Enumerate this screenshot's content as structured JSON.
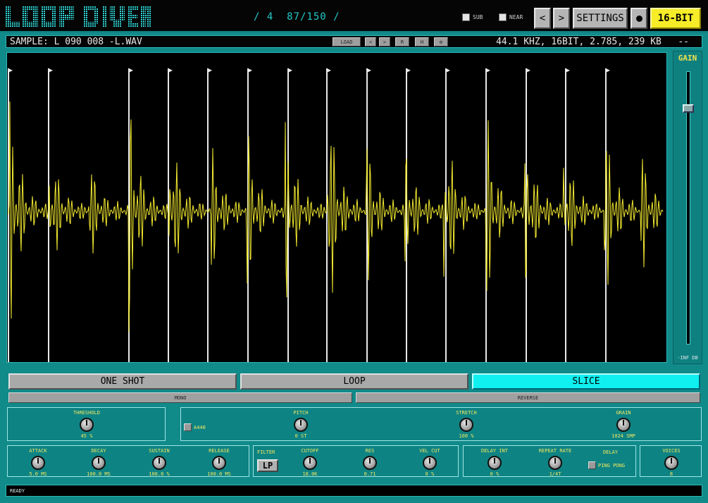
{
  "logo": {
    "text": "LOOP DIVER"
  },
  "header": {
    "counter": "/ 4  87/150 /",
    "sub_label": "SUB",
    "near_label": "NEAR",
    "prev_icon": "chevron-left",
    "next_icon": "chevron-right",
    "settings_label": "SETTINGS",
    "record_icon": "record-dot",
    "bit_depth_label": "16-BIT"
  },
  "sample": {
    "filename": "SAMPLE: L 090 008 -L.WAV",
    "meta": "44.1 KHZ, 16BIT, 2.785, 239 KB   --",
    "buttons": {
      "load": "LOAD",
      "prev": "<",
      "next": ">",
      "r": "R",
      "h": "H",
      "gear": "⚙"
    }
  },
  "gain": {
    "label": "GAIN",
    "bottom": "-INF DB",
    "level": 0.88
  },
  "modes": {
    "one_shot": "ONE SHOT",
    "loop": "LOOP",
    "slice": "SLICE",
    "active": "slice"
  },
  "options": {
    "mono": "MONO",
    "reverse": "REVERSE"
  },
  "threshold": {
    "label": "THRESHOLD",
    "value": "45 %"
  },
  "a440": {
    "label": "A440"
  },
  "pitch": {
    "label": "PITCH",
    "value": "0 ST"
  },
  "stretch": {
    "label": "STRETCH",
    "value": "100 %"
  },
  "grain": {
    "label": "GRAIN",
    "value": "1024 SMP"
  },
  "adsr": {
    "attack": {
      "label": "ATTACK",
      "value": "5.0 MS"
    },
    "decay": {
      "label": "DECAY",
      "value": "100.0 MS"
    },
    "sustain": {
      "label": "SUSTAIN",
      "value": "100.0 %"
    },
    "release": {
      "label": "RELEASE",
      "value": "100.0 MS"
    }
  },
  "filter": {
    "label": "FILTER",
    "type": "LP",
    "cutoff": {
      "label": "CUTOFF",
      "value": "18.0K"
    },
    "res": {
      "label": "RES",
      "value": "0.71"
    },
    "vel_cut": {
      "label": "VEL CUT",
      "value": "0 %"
    }
  },
  "delay": {
    "delay_int": {
      "label": "DELAY INT",
      "value": "0 %"
    },
    "repeat_rate": {
      "label": "REPEAT RATE",
      "value": "1/4T"
    },
    "label": "DELAY",
    "ping_pong": "PING PONG"
  },
  "voices": {
    "label": "VOICES",
    "value": "8"
  },
  "status": {
    "text": "READY"
  },
  "colors": {
    "wave": "#f5ec30",
    "accent": "#10f0f0",
    "panel": "#118a8a"
  }
}
